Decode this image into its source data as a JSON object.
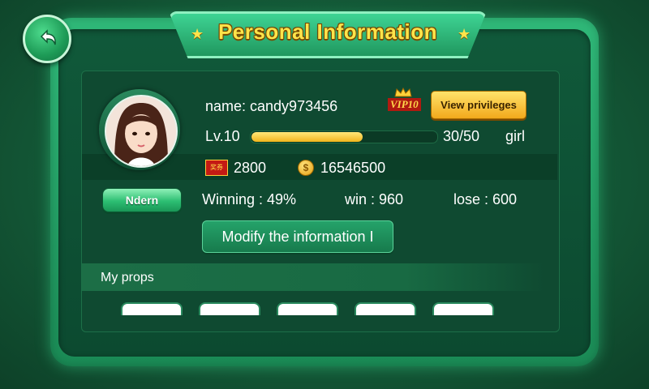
{
  "header": {
    "title": "Personal Information"
  },
  "profile": {
    "name_label": "name: candy973456",
    "vip_badge": "VIP10",
    "view_privileges_label": "View privileges",
    "level_label": "Lv.10",
    "exp_current": 30,
    "exp_max": 50,
    "exp_text": "30/50",
    "gender": "girl",
    "tickets": "2800",
    "coins": "16546500",
    "ticket_icon_text": "奖券",
    "coin_icon_text": "$"
  },
  "stats": {
    "title_button_label": "Ndern",
    "winning": "Winning : 49%",
    "win": "win : 960",
    "lose": "lose : 600"
  },
  "actions": {
    "modify_label": "Modify the information I"
  },
  "props": {
    "header": "My props",
    "slots": [
      "",
      "",
      "",
      "",
      ""
    ]
  },
  "colors": {
    "accent_gold": "#ffe44a",
    "panel_green": "#0f4a31",
    "bar_fill": "#f1b51c"
  },
  "icons": {
    "back": "back-arrow-icon",
    "star": "star-icon",
    "crown": "crown-icon",
    "ticket": "ticket-icon",
    "coin": "coin-icon"
  }
}
